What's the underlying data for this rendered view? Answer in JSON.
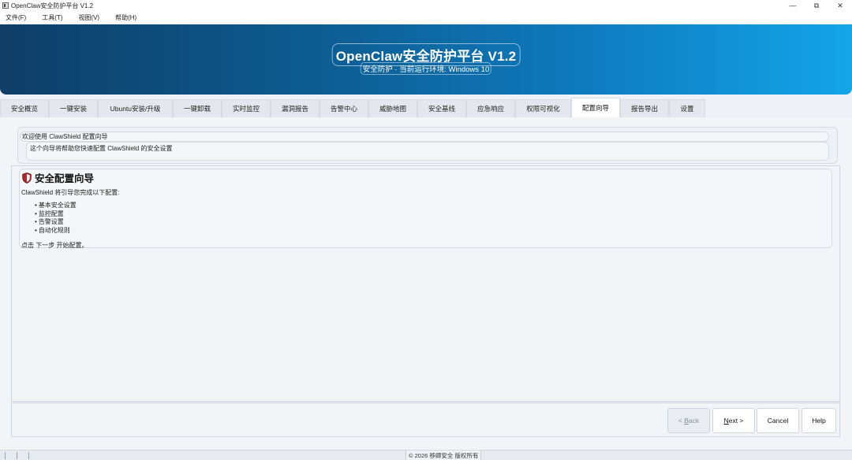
{
  "window": {
    "title": "OpenClaw安全防护平台 V1.2",
    "minimize_glyph": "—",
    "restore_glyph": "⧉",
    "close_glyph": "✕"
  },
  "menu": [
    "文件(F)",
    "工具(T)",
    "视图(V)",
    "帮助(H)"
  ],
  "banner": {
    "title": "OpenClaw安全防护平台 V1.2",
    "subtitle": "安全防护 · 当前运行环境: Windows 10"
  },
  "tabs": [
    {
      "label": "安全概览"
    },
    {
      "label": "一键安装"
    },
    {
      "label": "Ubuntu安装/升级"
    },
    {
      "label": "一键卸载"
    },
    {
      "label": "实时监控"
    },
    {
      "label": "漏洞报告"
    },
    {
      "label": "告警中心"
    },
    {
      "label": "威胁地图"
    },
    {
      "label": "安全基线"
    },
    {
      "label": "应急响应"
    },
    {
      "label": "权限可视化"
    },
    {
      "label": "配置向导",
      "active": true
    },
    {
      "label": "报告导出"
    },
    {
      "label": "设置"
    }
  ],
  "welcome": {
    "title": "欢迎使用 ClawShield 配置向导",
    "description": "这个向导将帮助您快速配置 ClawShield 的安全设置"
  },
  "wizard": {
    "heading": "安全配置向导",
    "heading_icon": "shield-icon",
    "intro": "ClawShield 将引导您完成以下配置:",
    "steps": [
      "基本安全设置",
      "监控配置",
      "告警设置",
      "自动化规则"
    ],
    "note": "点击 下一步 开始配置。"
  },
  "buttons": {
    "back_prefix": "< ",
    "back_key": "B",
    "back_rest": "ack",
    "next_key": "N",
    "next_rest": "ext >",
    "cancel": "Cancel",
    "help": "Help"
  },
  "status": {
    "copyright": "© 2026 移卿安全 版权所有"
  },
  "colors": {
    "banner_start": "#0f3d66",
    "banner_end": "#14a5e8",
    "shield_red": "#b3262e"
  }
}
